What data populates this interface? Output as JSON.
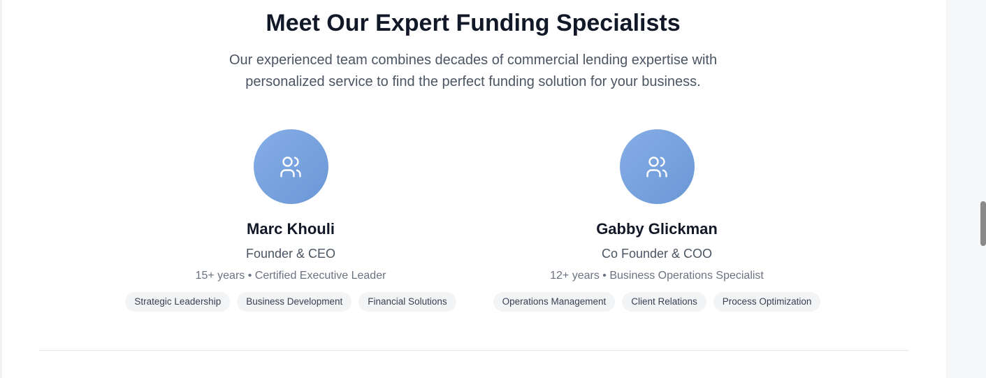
{
  "section": {
    "title": "Meet Our Expert Funding Specialists",
    "subtitle": "Our experienced team combines decades of commercial lending expertise with personalized service to find the perfect funding solution for your business."
  },
  "team": [
    {
      "icon": "users-icon",
      "name": "Marc Khouli",
      "role": "Founder & CEO",
      "meta": "15+ years • Certified Executive Leader",
      "tags": [
        "Strategic Leadership",
        "Business Development",
        "Financial Solutions"
      ]
    },
    {
      "icon": "users-icon",
      "name": "Gabby Glickman",
      "role": "Co Founder & COO",
      "meta": "12+ years • Business Operations Specialist",
      "tags": [
        "Operations Management",
        "Client Relations",
        "Process Optimization"
      ]
    }
  ],
  "colors": {
    "avatar_gradient_start": "#86ade6",
    "avatar_gradient_end": "#6a98d6",
    "heading": "#111827",
    "body_text": "#4b5563",
    "tag_bg": "#f3f4f6"
  }
}
